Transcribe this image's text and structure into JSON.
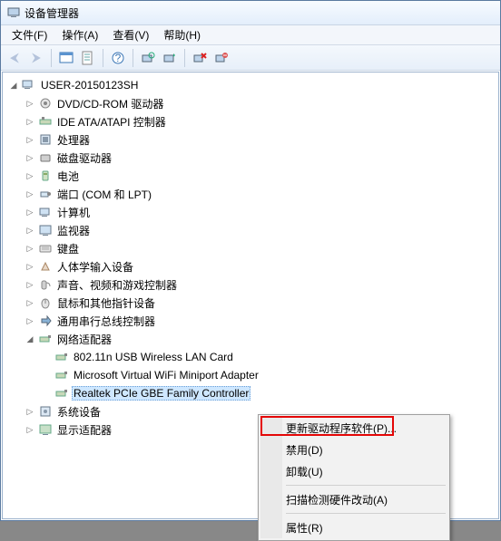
{
  "window": {
    "title": "设备管理器"
  },
  "menubar": {
    "file": "文件(F)",
    "action": "操作(A)",
    "view": "查看(V)",
    "help": "帮助(H)"
  },
  "tree": {
    "root": "USER-20150123SH",
    "items": [
      "DVD/CD-ROM 驱动器",
      "IDE ATA/ATAPI 控制器",
      "处理器",
      "磁盘驱动器",
      "电池",
      "端口 (COM 和 LPT)",
      "计算机",
      "监视器",
      "键盘",
      "人体学输入设备",
      "声音、视频和游戏控制器",
      "鼠标和其他指针设备",
      "通用串行总线控制器",
      "网络适配器",
      "系统设备",
      "显示适配器"
    ],
    "network": {
      "nic0": "802.11n USB Wireless LAN Card",
      "nic1": "Microsoft Virtual WiFi Miniport Adapter",
      "nic2": "Realtek PCIe GBE Family Controller"
    }
  },
  "context_menu": {
    "update": "更新驱动程序软件(P)...",
    "disable": "禁用(D)",
    "uninstall": "卸载(U)",
    "scan": "扫描检测硬件改动(A)",
    "properties": "属性(R)"
  }
}
